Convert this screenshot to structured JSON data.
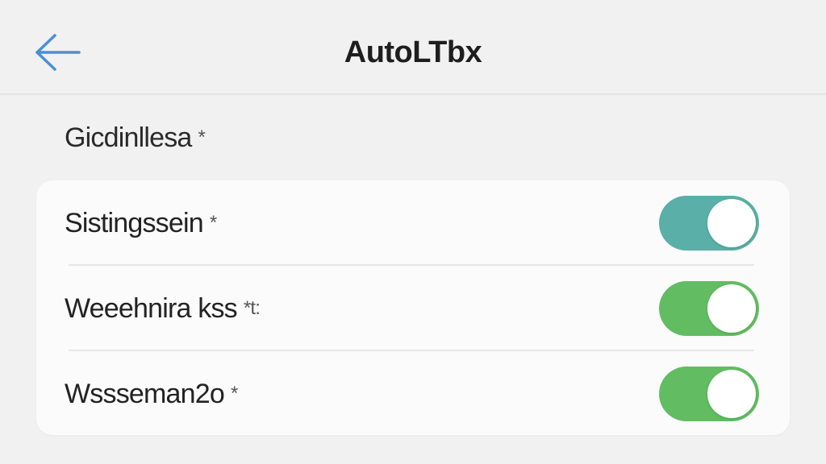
{
  "header": {
    "title": "AutoLTbx",
    "back_icon": "arrow-left-icon",
    "back_icon_color": "#4a8fd6"
  },
  "section": {
    "title": "Gicdinllesa",
    "marker": "*"
  },
  "settings": [
    {
      "label": "Sistingssein",
      "marker": "*",
      "toggle_on": true,
      "toggle_color": "#5aafa8"
    },
    {
      "label": "Weeehnira kss",
      "marker": "*t:",
      "toggle_on": true,
      "toggle_color": "#62bd62"
    },
    {
      "label": "Wssseman2o",
      "marker": "*",
      "toggle_on": true,
      "toggle_color": "#62bd62"
    }
  ],
  "colors": {
    "background": "#f1f1f2",
    "card": "#fbfbfb",
    "divider": "#e6e6e8"
  }
}
